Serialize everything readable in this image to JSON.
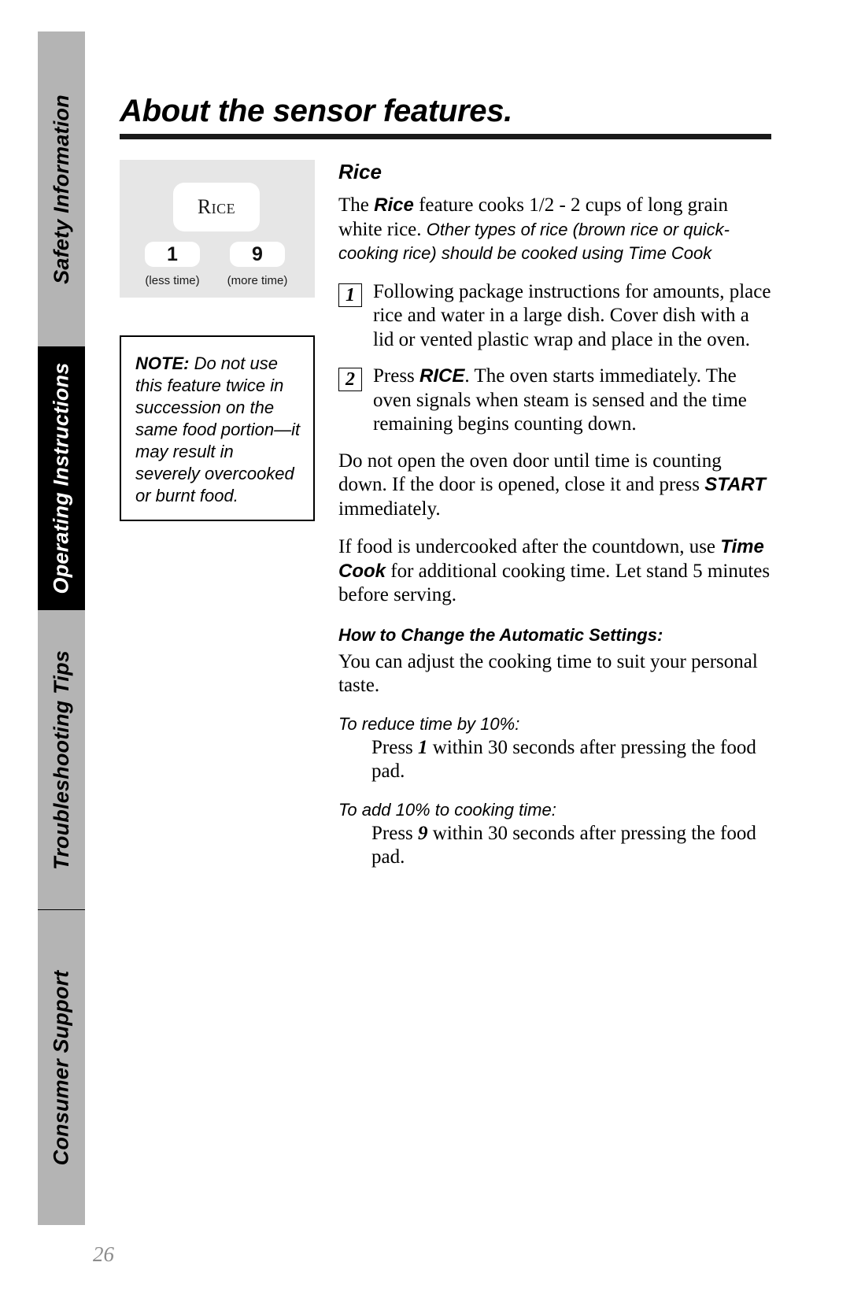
{
  "page": {
    "title": "About the sensor features.",
    "number": "26"
  },
  "sidebar": {
    "tabs": [
      {
        "label": "Safety Information",
        "style": "gray"
      },
      {
        "label": "Operating Instructions",
        "style": "black"
      },
      {
        "label": "Troubleshooting Tips",
        "style": "gray"
      },
      {
        "label": "Consumer Support",
        "style": "gray"
      }
    ]
  },
  "control_panel": {
    "rice_key_label": "Rice",
    "less_key_value": "1",
    "more_key_value": "9",
    "less_caption": "(less time)",
    "more_caption": "(more time)"
  },
  "note": {
    "label": "NOTE:",
    "text": " Do not use this feature twice in succession on the same food portion—it may result in severely overcooked or burnt food."
  },
  "rice": {
    "heading": "Rice",
    "intro_a": "The ",
    "intro_em": "Rice",
    "intro_b": " feature cooks 1/2 - 2 cups of long grain white rice. ",
    "intro_italic": "Other types of rice (brown rice or quick-cooking rice) should be cooked using Time Cook",
    "steps": [
      {
        "number": "1",
        "text": "Following package instructions for amounts, place rice and water in a large dish. Cover dish with a lid or vented plastic wrap and place in the oven."
      },
      {
        "number": "2",
        "text_a": "Press ",
        "text_em": "RICE",
        "text_b": ". The oven starts immediately. The oven signals when steam is sensed and the time remaining begins counting down."
      }
    ],
    "para_door_a": "Do not open the oven door until time is counting down. If the door is opened, close it and press ",
    "para_door_em": "START",
    "para_door_b": " immediately.",
    "para_under_a": "If food is undercooked after the countdown, use ",
    "para_under_em": "Time Cook",
    "para_under_b": " for additional cooking time. Let stand 5 minutes before serving.",
    "settings_heading": "How to Change the Automatic Settings:",
    "settings_intro": "You can adjust the cooking time to suit your personal taste.",
    "reduce_heading": "To reduce time by 10%:",
    "reduce_a": "Press ",
    "reduce_em": "1",
    "reduce_b": " within 30 seconds after pressing the food pad.",
    "add_heading": "To add 10% to cooking time:",
    "add_a": "Press ",
    "add_em": "9",
    "add_b": " within 30 seconds after pressing the food pad."
  },
  "colors": {
    "tab_gray": "#b4b4b4",
    "tab_black": "#000000",
    "panel_gray": "#e6e6e6",
    "page_number_gray": "#8c8c8c"
  }
}
